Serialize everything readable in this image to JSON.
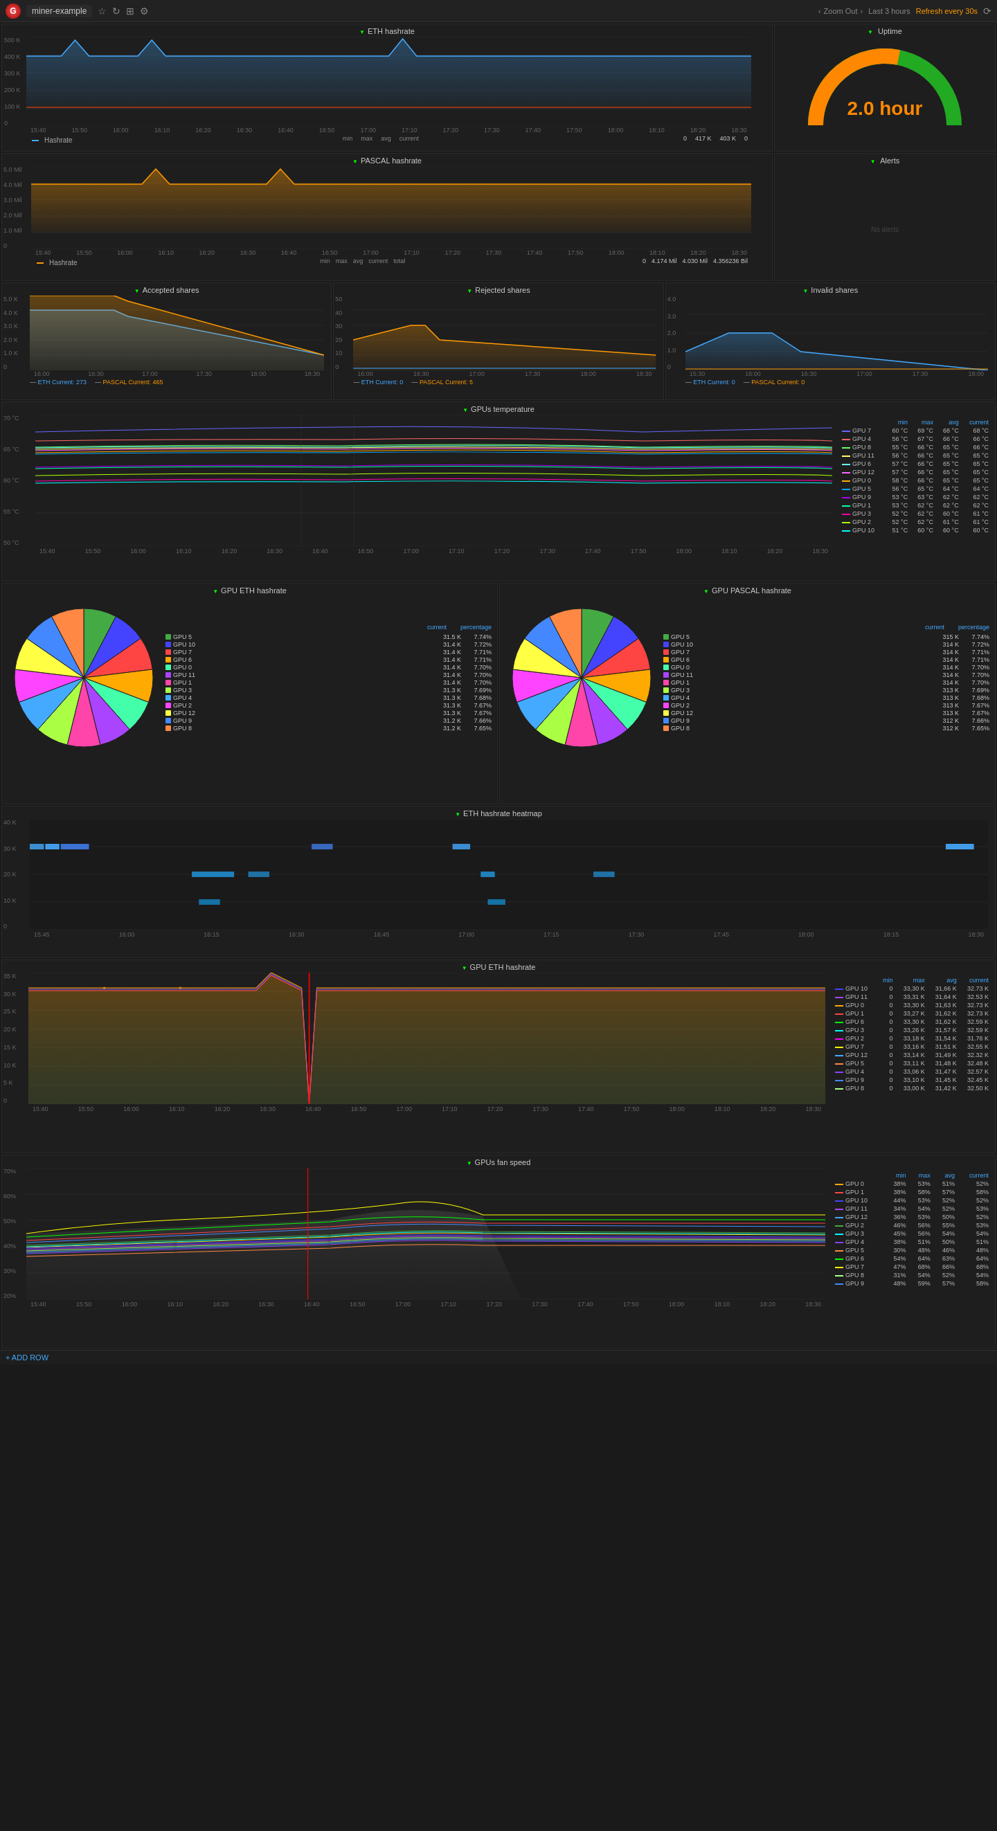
{
  "nav": {
    "logo": "G",
    "title": "miner-example",
    "zoom_out": "Zoom Out",
    "time_range": "Last 3 hours",
    "refresh": "Refresh every 30s"
  },
  "eth_hashrate": {
    "title": "ETH hashrate",
    "y_labels": [
      "500 K",
      "400 K",
      "300 K",
      "200 K",
      "100 K",
      "0"
    ],
    "x_labels": [
      "15:40",
      "15:50",
      "16:00",
      "16:10",
      "16:20",
      "16:30",
      "16:40",
      "16:50",
      "17:00",
      "17:10",
      "17:20",
      "17:30",
      "17:40",
      "17:50",
      "18:00",
      "18:10",
      "18:20",
      "18:30"
    ],
    "legend": "Hashrate",
    "stats": {
      "min": "0",
      "max": "417 K",
      "avg": "403 K",
      "current": "0"
    }
  },
  "uptime": {
    "title": "Uptime",
    "value": "2.0 hour"
  },
  "pascal_hashrate": {
    "title": "PASCAL hashrate",
    "y_labels": [
      "5.0 Mil",
      "4.0 Mil",
      "3.0 Mil",
      "2.0 Mil",
      "1.0 Mil",
      "0"
    ],
    "x_labels": [
      "15:40",
      "15:50",
      "16:00",
      "16:10",
      "16:20",
      "16:30",
      "16:40",
      "16:50",
      "17:00",
      "17:10",
      "17:20",
      "17:30",
      "17:40",
      "17:50",
      "18:00",
      "18:10",
      "18:20",
      "18:30"
    ],
    "legend": "Hashrate",
    "stats": {
      "min": "0",
      "max": "4.174 Mil",
      "avg": "4.030 Mil",
      "current": "4.356236 Bil",
      "total": ""
    }
  },
  "alerts": {
    "title": "Alerts"
  },
  "accepted_shares": {
    "title": "Accepted shares",
    "y_labels": [
      "5.0 K",
      "4.0 K",
      "3.0 K",
      "2.0 K",
      "1.0 K",
      "0"
    ],
    "x_labels": [
      "16:00",
      "16:30",
      "17:00",
      "17:30",
      "18:00",
      "18:30"
    ],
    "legend_eth": "ETH Current: 273",
    "legend_pascal": "PASCAL Current: 465"
  },
  "rejected_shares": {
    "title": "Rejected shares",
    "y_labels": [
      "50",
      "40",
      "30",
      "20",
      "10",
      "0"
    ],
    "x_labels": [
      "16:00",
      "16:30",
      "17:00",
      "17:30",
      "18:00",
      "18:30"
    ],
    "legend_eth": "ETH Current: 0",
    "legend_pascal": "PASCAL Current: 5"
  },
  "invalid_shares": {
    "title": "Invalid shares",
    "y_labels": [
      "4.0",
      "3.0",
      "2.0",
      "1.0",
      "0"
    ],
    "x_labels": [
      "15:30",
      "16:00",
      "16:30",
      "17:00",
      "17:30",
      "18:00"
    ],
    "legend_eth": "ETH Current: 0",
    "legend_pascal": "PASCAL Current: 0"
  },
  "gpu_temp": {
    "title": "GPUs temperature",
    "y_labels": [
      "70 °C",
      "65 °C",
      "60 °C",
      "55 °C",
      "50 °C"
    ],
    "x_labels": [
      "15:40",
      "15:50",
      "16:00",
      "16:10",
      "16:20",
      "16:30",
      "16:40",
      "16:50",
      "17:00",
      "17:10",
      "17:20",
      "17:30",
      "17:40",
      "17:50",
      "18:00",
      "18:10",
      "18:20",
      "18:30"
    ],
    "headers": [
      "",
      "min",
      "max",
      "avg",
      "current"
    ],
    "gpus": [
      {
        "name": "GPU 7",
        "color": "#66f",
        "min": "60 °C",
        "max": "69 °C",
        "avg": "68 °C",
        "current": "68 °C"
      },
      {
        "name": "GPU 4",
        "color": "#f66",
        "min": "56 °C",
        "max": "67 °C",
        "avg": "66 °C",
        "current": "66 °C"
      },
      {
        "name": "GPU 8",
        "color": "#6f6",
        "min": "55 °C",
        "max": "66 °C",
        "avg": "65 °C",
        "current": "66 °C"
      },
      {
        "name": "GPU 11",
        "color": "#ff6",
        "min": "56 °C",
        "max": "66 °C",
        "avg": "65 °C",
        "current": "65 °C"
      },
      {
        "name": "GPU 6",
        "color": "#6ff",
        "min": "57 °C",
        "max": "66 °C",
        "avg": "65 °C",
        "current": "65 °C"
      },
      {
        "name": "GPU 12",
        "color": "#f6f",
        "min": "57 °C",
        "max": "66 °C",
        "avg": "65 °C",
        "current": "65 °C"
      },
      {
        "name": "GPU 0",
        "color": "#fa0",
        "min": "58 °C",
        "max": "66 °C",
        "avg": "65 °C",
        "current": "65 °C"
      },
      {
        "name": "GPU 5",
        "color": "#0af",
        "min": "56 °C",
        "max": "65 °C",
        "avg": "64 °C",
        "current": "64 °C"
      },
      {
        "name": "GPU 9",
        "color": "#a0f",
        "min": "53 °C",
        "max": "63 °C",
        "avg": "62 °C",
        "current": "62 °C"
      },
      {
        "name": "GPU 1",
        "color": "#0fa",
        "min": "53 °C",
        "max": "62 °C",
        "avg": "62 °C",
        "current": "62 °C"
      },
      {
        "name": "GPU 3",
        "color": "#f0a",
        "min": "52 °C",
        "max": "62 °C",
        "avg": "60 °C",
        "current": "61 °C"
      },
      {
        "name": "GPU 2",
        "color": "#af0",
        "min": "52 °C",
        "max": "62 °C",
        "avg": "61 °C",
        "current": "61 °C"
      },
      {
        "name": "GPU 10",
        "color": "#0ff",
        "min": "51 °C",
        "max": "60 °C",
        "avg": "60 °C",
        "current": "60 °C"
      }
    ]
  },
  "gpu_eth_pie": {
    "title": "GPU ETH hashrate",
    "col_current": "current",
    "col_pct": "percentage",
    "items": [
      {
        "name": "GPU 5",
        "color": "#4a4",
        "current": "31.5 K",
        "pct": "7.74%"
      },
      {
        "name": "GPU 10",
        "color": "#44f",
        "current": "31.4 K",
        "pct": "7.72%"
      },
      {
        "name": "GPU 7",
        "color": "#f44",
        "current": "31.4 K",
        "pct": "7.71%"
      },
      {
        "name": "GPU 6",
        "color": "#fa0",
        "current": "31.4 K",
        "pct": "7.71%"
      },
      {
        "name": "GPU 0",
        "color": "#4fa",
        "current": "31.4 K",
        "pct": "7.70%"
      },
      {
        "name": "GPU 11",
        "color": "#a4f",
        "current": "31.4 K",
        "pct": "7.70%"
      },
      {
        "name": "GPU 1",
        "color": "#f4a",
        "current": "31.4 K",
        "pct": "7.70%"
      },
      {
        "name": "GPU 3",
        "color": "#af4",
        "current": "31.3 K",
        "pct": "7.69%"
      },
      {
        "name": "GPU 4",
        "color": "#4af",
        "current": "31.3 K",
        "pct": "7.68%"
      },
      {
        "name": "GPU 2",
        "color": "#f4f",
        "current": "31.3 K",
        "pct": "7.67%"
      },
      {
        "name": "GPU 12",
        "color": "#ff4",
        "current": "31.3 K",
        "pct": "7.67%"
      },
      {
        "name": "GPU 9",
        "color": "#48f",
        "current": "31.2 K",
        "pct": "7.66%"
      },
      {
        "name": "GPU 8",
        "color": "#f84",
        "current": "31.2 K",
        "pct": "7.65%"
      }
    ]
  },
  "gpu_pascal_pie": {
    "title": "GPU PASCAL hashrate",
    "col_current": "current",
    "col_pct": "percentage",
    "items": [
      {
        "name": "GPU 5",
        "color": "#4a4",
        "current": "315 K",
        "pct": "7.74%"
      },
      {
        "name": "GPU 10",
        "color": "#44f",
        "current": "314 K",
        "pct": "7.72%"
      },
      {
        "name": "GPU 7",
        "color": "#f44",
        "current": "314 K",
        "pct": "7.71%"
      },
      {
        "name": "GPU 6",
        "color": "#fa0",
        "current": "314 K",
        "pct": "7.71%"
      },
      {
        "name": "GPU 0",
        "color": "#4fa",
        "current": "314 K",
        "pct": "7.70%"
      },
      {
        "name": "GPU 11",
        "color": "#a4f",
        "current": "314 K",
        "pct": "7.70%"
      },
      {
        "name": "GPU 1",
        "color": "#f4a",
        "current": "314 K",
        "pct": "7.70%"
      },
      {
        "name": "GPU 3",
        "color": "#af4",
        "current": "313 K",
        "pct": "7.69%"
      },
      {
        "name": "GPU 4",
        "color": "#4af",
        "current": "313 K",
        "pct": "7.68%"
      },
      {
        "name": "GPU 2",
        "color": "#f4f",
        "current": "313 K",
        "pct": "7.67%"
      },
      {
        "name": "GPU 12",
        "color": "#ff4",
        "current": "313 K",
        "pct": "7.67%"
      },
      {
        "name": "GPU 9",
        "color": "#48f",
        "current": "312 K",
        "pct": "7.66%"
      },
      {
        "name": "GPU 8",
        "color": "#f84",
        "current": "312 K",
        "pct": "7.65%"
      }
    ]
  },
  "eth_heatmap": {
    "title": "ETH hashrate heatmap",
    "y_labels": [
      "40 K",
      "30 K",
      "20 K",
      "10 K",
      "0"
    ],
    "x_labels": [
      "15:45",
      "16:00",
      "16:15",
      "16:30",
      "16:45",
      "17:00",
      "17:15",
      "17:30",
      "17:45",
      "18:00",
      "18:15",
      "18:30"
    ]
  },
  "gpu_eth_line": {
    "title": "GPU ETH hashrate",
    "y_labels": [
      "35 K",
      "30 K",
      "25 K",
      "20 K",
      "15 K",
      "10 K",
      "5 K",
      "0"
    ],
    "x_labels": [
      "15:40",
      "15:50",
      "16:00",
      "16:10",
      "16:20",
      "16:30",
      "16:40",
      "16:50",
      "17:00",
      "17:10",
      "17:20",
      "17:30",
      "17:40",
      "17:50",
      "18:00",
      "18:10",
      "18:20",
      "18:30"
    ],
    "headers": [
      "",
      "min",
      "max",
      "avg",
      "current"
    ],
    "gpus": [
      {
        "name": "GPU 10",
        "color": "#44f",
        "min": "0",
        "max": "33,30 K",
        "avg": "31,66 K",
        "current": "32.73 K"
      },
      {
        "name": "GPU 11",
        "color": "#a4f",
        "min": "0",
        "max": "33,31 K",
        "avg": "31,64 K",
        "current": "32.53 K"
      },
      {
        "name": "GPU 0",
        "color": "#fa0",
        "min": "0",
        "max": "33,30 K",
        "avg": "31,63 K",
        "current": "32.73 K"
      },
      {
        "name": "GPU 1",
        "color": "#f44",
        "min": "0",
        "max": "33,27 K",
        "avg": "31,62 K",
        "current": "32.73 K"
      },
      {
        "name": "GPU 6",
        "color": "#0f0",
        "min": "0",
        "max": "33,30 K",
        "avg": "31,62 K",
        "current": "32.59 K"
      },
      {
        "name": "GPU 3",
        "color": "#0ff",
        "min": "0",
        "max": "33,26 K",
        "avg": "31,57 K",
        "current": "32.59 K"
      },
      {
        "name": "GPU 2",
        "color": "#f0f",
        "min": "0",
        "max": "33,18 K",
        "avg": "31,54 K",
        "current": "31.76 K"
      },
      {
        "name": "GPU 7",
        "color": "#ff0",
        "min": "0",
        "max": "33,16 K",
        "avg": "31,51 K",
        "current": "32.55 K"
      },
      {
        "name": "GPU 12",
        "color": "#4af",
        "min": "0",
        "max": "33,14 K",
        "avg": "31,49 K",
        "current": "32.32 K"
      },
      {
        "name": "GPU 5",
        "color": "#f84",
        "min": "0",
        "max": "33,11 K",
        "avg": "31,48 K",
        "current": "32.48 K"
      },
      {
        "name": "GPU 4",
        "color": "#84f",
        "min": "0",
        "max": "33,06 K",
        "avg": "31,47 K",
        "current": "32.57 K"
      },
      {
        "name": "GPU 9",
        "color": "#48f",
        "min": "0",
        "max": "33,10 K",
        "avg": "31,45 K",
        "current": "32.45 K"
      },
      {
        "name": "GPU 8",
        "color": "#af8",
        "min": "0",
        "max": "33,00 K",
        "avg": "31,42 K",
        "current": "32.50 K"
      }
    ]
  },
  "gpu_fan": {
    "title": "GPUs fan speed",
    "y_labels": [
      "70%",
      "60%",
      "50%",
      "40%",
      "30%",
      "20%"
    ],
    "x_labels": [
      "15:40",
      "15:50",
      "16:00",
      "16:10",
      "16:20",
      "16:30",
      "16:40",
      "16:50",
      "17:00",
      "17:10",
      "17:20",
      "17:30",
      "17:40",
      "17:50",
      "18:00",
      "18:10",
      "18:20",
      "18:30"
    ],
    "headers": [
      "",
      "min",
      "max",
      "avg",
      "current"
    ],
    "gpus": [
      {
        "name": "GPU 0",
        "color": "#fa0",
        "min": "38%",
        "max": "53%",
        "avg": "51%",
        "current": "52%"
      },
      {
        "name": "GPU 1",
        "color": "#f44",
        "min": "38%",
        "max": "58%",
        "avg": "57%",
        "current": "58%"
      },
      {
        "name": "GPU 10",
        "color": "#44f",
        "min": "44%",
        "max": "53%",
        "avg": "52%",
        "current": "52%"
      },
      {
        "name": "GPU 11",
        "color": "#a4f",
        "min": "34%",
        "max": "54%",
        "avg": "52%",
        "current": "53%"
      },
      {
        "name": "GPU 12",
        "color": "#4af",
        "min": "36%",
        "max": "53%",
        "avg": "50%",
        "current": "52%"
      },
      {
        "name": "GPU 2",
        "color": "#4a4",
        "min": "46%",
        "max": "56%",
        "avg": "55%",
        "current": "53%"
      },
      {
        "name": "GPU 3",
        "color": "#0ff",
        "min": "45%",
        "max": "56%",
        "avg": "54%",
        "current": "54%"
      },
      {
        "name": "GPU 4",
        "color": "#84f",
        "min": "38%",
        "max": "51%",
        "avg": "50%",
        "current": "51%"
      },
      {
        "name": "GPU 5",
        "color": "#f84",
        "min": "30%",
        "max": "48%",
        "avg": "46%",
        "current": "48%"
      },
      {
        "name": "GPU 6",
        "color": "#0f0",
        "min": "54%",
        "max": "64%",
        "avg": "63%",
        "current": "64%"
      },
      {
        "name": "GPU 7",
        "color": "#ff0",
        "min": "47%",
        "max": "68%",
        "avg": "66%",
        "current": "68%"
      },
      {
        "name": "GPU 8",
        "color": "#af8",
        "min": "31%",
        "max": "54%",
        "avg": "52%",
        "current": "54%"
      },
      {
        "name": "GPU 9",
        "color": "#48f",
        "min": "48%",
        "max": "59%",
        "avg": "57%",
        "current": "58%"
      }
    ]
  },
  "bottom_bar": {
    "add_row": "+ ADD ROW"
  }
}
